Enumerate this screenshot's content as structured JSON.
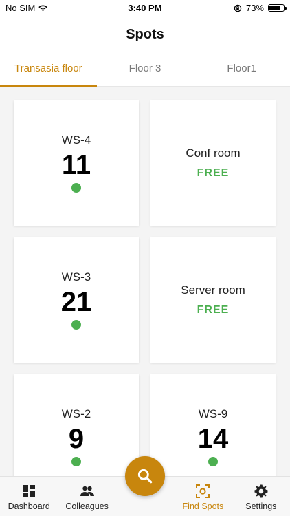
{
  "status_bar": {
    "carrier": "No SIM",
    "time": "3:40 PM",
    "battery": "73%",
    "battery_level": 0.73
  },
  "header": {
    "title": "Spots"
  },
  "tabs": [
    {
      "label": "Transasia floor",
      "active": true
    },
    {
      "label": "Floor 3",
      "active": false
    },
    {
      "label": "Floor1",
      "active": false
    }
  ],
  "spots": [
    {
      "name": "WS-4",
      "count": "11",
      "status": "available"
    },
    {
      "name": "Conf room",
      "status_text": "FREE"
    },
    {
      "name": "WS-3",
      "count": "21",
      "status": "available"
    },
    {
      "name": "Server room",
      "status_text": "FREE"
    },
    {
      "name": "WS-2",
      "count": "9",
      "status": "available"
    },
    {
      "name": "WS-9",
      "count": "14",
      "status": "available"
    }
  ],
  "bottom_nav": {
    "dashboard": "Dashboard",
    "colleagues": "Colleagues",
    "find_spots": "Find Spots",
    "settings": "Settings"
  },
  "icons": {
    "fab": "search-icon",
    "dashboard": "dashboard-icon",
    "colleagues": "people-icon",
    "find_spots": "find-spots-icon",
    "settings": "gear-icon"
  },
  "colors": {
    "accent": "#c8860d",
    "available": "#4caf50",
    "free_text": "#4caf50"
  }
}
